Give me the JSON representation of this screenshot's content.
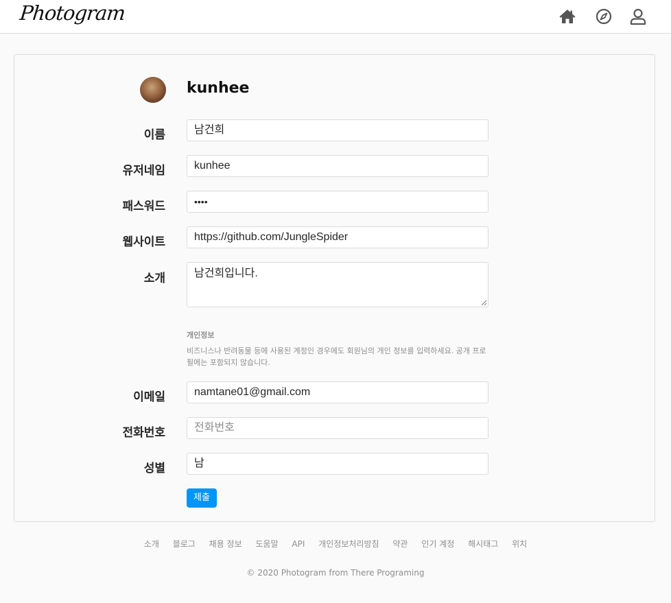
{
  "header": {
    "logo": "Photogram",
    "icons": [
      "home-icon",
      "compass-icon",
      "user-icon"
    ]
  },
  "profile": {
    "username": "kunhee"
  },
  "form": {
    "name": {
      "label": "이름",
      "value": "남건희"
    },
    "username": {
      "label": "유저네임",
      "value": "kunhee"
    },
    "password": {
      "label": "패스워드",
      "value": "••••"
    },
    "website": {
      "label": "웹사이트",
      "value": "https://github.com/JungleSpider"
    },
    "bio": {
      "label": "소개",
      "value": "남건희입니다."
    },
    "private_info": {
      "title": "개인정보",
      "description": "비즈니스나 반려동물 등에 사용된 계정인 경우에도 회원님의 개인 정보를 입력하세요. 공개 프로필에는 포함되지 않습니다."
    },
    "email": {
      "label": "이메일",
      "value": "namtane01@gmail.com"
    },
    "phone": {
      "label": "전화번호",
      "value": "",
      "placeholder": "전화번호"
    },
    "gender": {
      "label": "성별",
      "value": "남"
    },
    "submit_label": "제출"
  },
  "footer": {
    "links": [
      "소개",
      "블로그",
      "채용 정보",
      "도움말",
      "API",
      "개인정보처리방침",
      "약관",
      "인기 계정",
      "해시태그",
      "위치"
    ],
    "copyright": "© 2020 Photogram from There Programing"
  },
  "colors": {
    "accent": "#0095f6",
    "border": "#dbdbdb",
    "background": "#fafafa"
  }
}
